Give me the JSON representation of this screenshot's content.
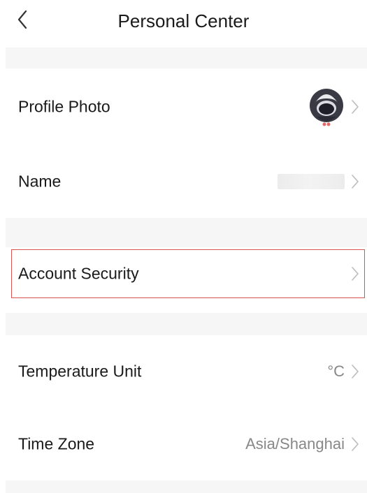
{
  "header": {
    "title": "Personal Center",
    "back_icon": "chevron-left-icon"
  },
  "rows": {
    "profile_photo": {
      "label": "Profile Photo",
      "avatar_icon": "avatar-icon"
    },
    "name": {
      "label": "Name",
      "value": ""
    },
    "account_security": {
      "label": "Account Security",
      "highlight_color": "#d9534f"
    },
    "temperature_unit": {
      "label": "Temperature Unit",
      "value": "°C"
    },
    "time_zone": {
      "label": "Time Zone",
      "value": "Asia/Shanghai"
    }
  },
  "colors": {
    "background": "#ffffff",
    "section_gap": "#f6f6f6",
    "text_primary": "#1a1a1a",
    "text_secondary": "#888888",
    "chevron": "#bdbdbd"
  }
}
